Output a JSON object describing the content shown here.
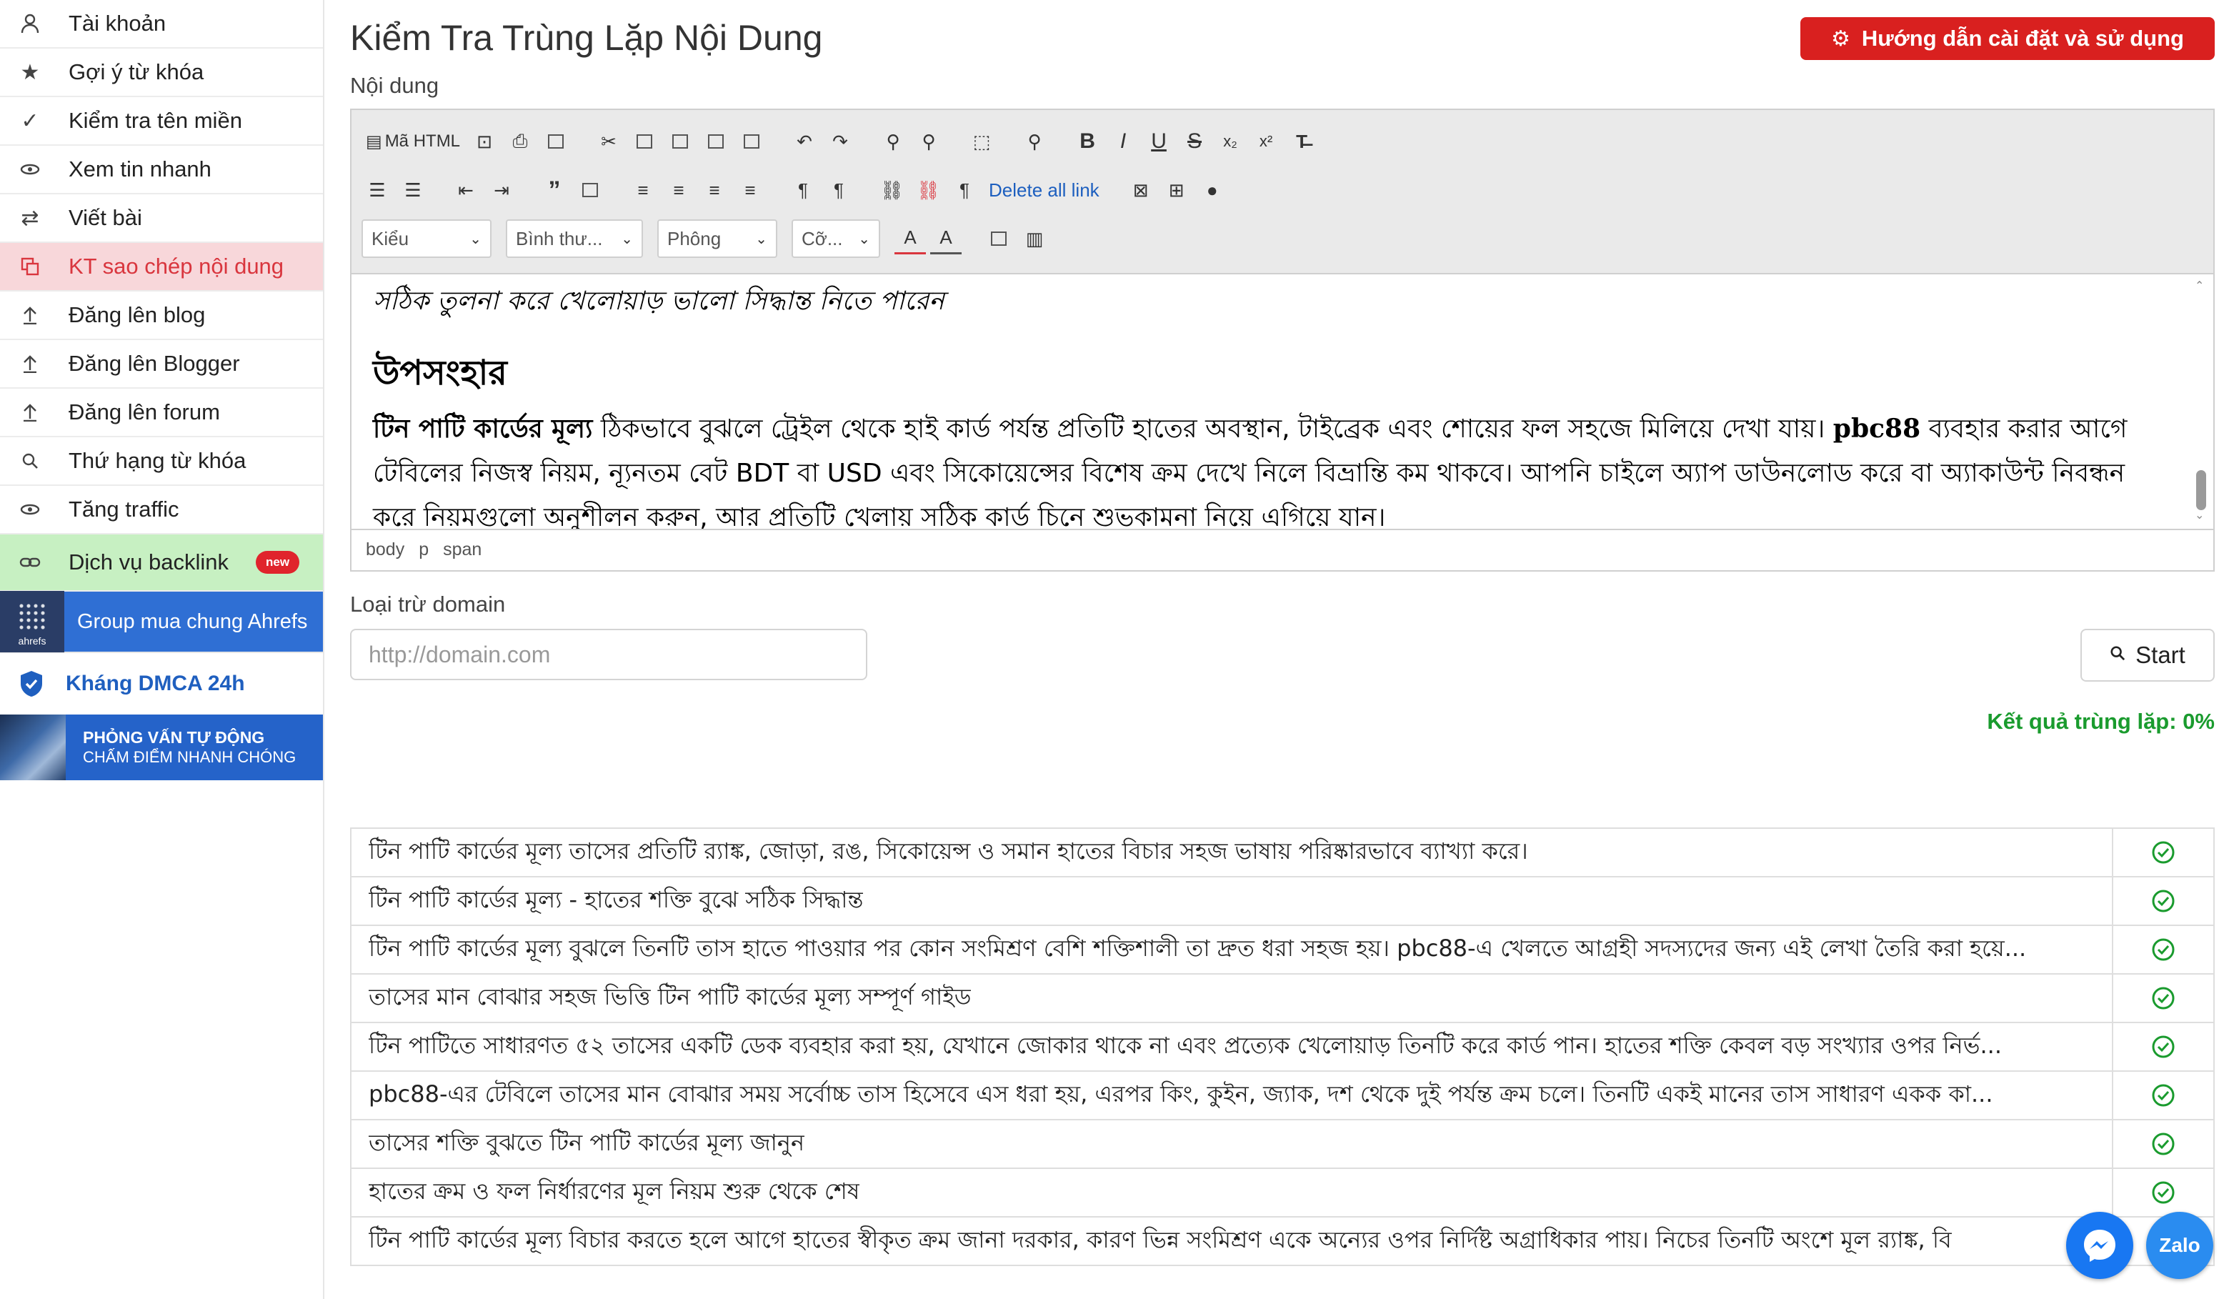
{
  "sidebar": {
    "items": [
      {
        "label": "Tài khoản",
        "icon": "user-icon"
      },
      {
        "label": "Gợi ý từ khóa",
        "icon": "star-icon"
      },
      {
        "label": "Kiểm tra tên miền",
        "icon": "check-icon"
      },
      {
        "label": "Xem tin nhanh",
        "icon": "eye-icon"
      },
      {
        "label": "Viết bài",
        "icon": "swap-icon"
      },
      {
        "label": "KT sao chép nội dung",
        "icon": "copy-icon"
      },
      {
        "label": "Đăng lên blog",
        "icon": "upload-icon"
      },
      {
        "label": "Đăng lên Blogger",
        "icon": "upload-icon"
      },
      {
        "label": "Đăng lên forum",
        "icon": "upload-icon"
      },
      {
        "label": "Thứ hạng từ khóa",
        "icon": "search-icon"
      },
      {
        "label": "Tăng traffic",
        "icon": "eye-icon"
      },
      {
        "label": "Dịch vụ backlink",
        "icon": "link-icon",
        "badge": "new"
      }
    ],
    "ahrefs_banner": {
      "logo_text": "ahrefs",
      "label": "Group mua chung Ahrefs"
    },
    "dmca": {
      "label": "Kháng DMCA 24h"
    },
    "interview_banner": {
      "line1": "PHỎNG VẤN TỰ ĐỘNG",
      "line2": "CHẤM ĐIỂM NHANH CHÓNG"
    }
  },
  "header": {
    "title": "Kiểm Tra Trùng Lặp Nội Dung",
    "guide_button": "Hướng dẫn cài đặt và sử dụng"
  },
  "editor": {
    "label": "Nội dung",
    "toolbar": {
      "source_label": "Mã HTML",
      "delete_links_label": "Delete all link",
      "bold": "B",
      "italic": "I",
      "underline": "U",
      "strike": "S",
      "subscript": "x₂",
      "superscript": "x²",
      "selects": {
        "style": "Kiểu",
        "format": "Bình thư...",
        "font": "Phông",
        "size": "Cỡ..."
      }
    },
    "content": {
      "italic_line": "সঠিক তুলনা করে খেলোয়াড় ভালো সিদ্ধান্ত নিতে পারেন",
      "heading": "উপসংহার",
      "para_bold": "টিন পাটি কার্ডের মূল্য",
      "para_text": " ঠিকভাবে বুঝলে ট্রেইল থেকে হাই কার্ড পর্যন্ত প্রতিটি হাতের অবস্থান, টাইব্রেক এবং শোয়ের ফল সহজে মিলিয়ে দেখা যায়। ",
      "para_brand": "pbc88",
      "para_text2": " ব্যবহার করার আগে টেবিলের নিজস্ব নিয়ম, ন্যূনতম বেট BDT বা USD এবং সিকোয়েন্সের বিশেষ ক্রম দেখে নিলে বিভ্রান্তি কম থাকবে। আপনি চাইলে অ্যাপ ডাউনলোড করে বা অ্যাকাউন্ট নিবন্ধন করে নিয়মগুলো অনুশীলন করুন, আর প্রতিটি খেলায় সঠিক কার্ড চিনে শুভকামনা নিয়ে এগিয়ে যান।"
    },
    "status_path": [
      "body",
      "p",
      "span"
    ]
  },
  "exclude": {
    "label": "Loại trừ domain",
    "placeholder": "http://domain.com"
  },
  "start_button": "Start",
  "result_text": "Kết quả trùng lặp: 0%",
  "results": [
    "টিন পাটি কার্ডের মূল্য তাসের প্রতিটি র‍্যাঙ্ক, জোড়া, রঙ, সিকোয়েন্স ও সমান হাতের বিচার সহজ ভাষায় পরিষ্কারভাবে ব্যাখ্যা করে।",
    "টিন পাটি কার্ডের মূল্য - হাতের শক্তি বুঝে সঠিক সিদ্ধান্ত",
    "টিন পাটি কার্ডের মূল্য বুঝলে তিনটি তাস হাতে পাওয়ার পর কোন সংমিশ্রণ বেশি শক্তিশালী তা দ্রুত ধরা সহজ হয়। pbc88-এ খেলতে আগ্রহী সদস্যদের জন্য এই লেখা তৈরি করা হয়ে...",
    "তাসের মান বোঝার সহজ ভিত্তি টিন পাটি কার্ডের মূল্য সম্পূর্ণ গাইড",
    "টিন পাটিতে সাধারণত ৫২ তাসের একটি ডেক ব্যবহার করা হয়, যেখানে জোকার থাকে না এবং প্রত্যেক খেলোয়াড় তিনটি করে কার্ড পান। হাতের শক্তি কেবল বড় সংখ্যার ওপর নির্ভ...",
    "pbc88-এর টেবিলে তাসের মান বোঝার সময় সর্বোচ্চ তাস হিসেবে এস ধরা হয়, এরপর কিং, কুইন, জ্যাক, দশ থেকে দুই পর্যন্ত ক্রম চলে। তিনটি একই মানের তাস সাধারণ একক কা...",
    "তাসের শক্তি বুঝতে টিন পাটি কার্ডের মূল্য জানুন",
    "হাতের ক্রম ও ফল নির্ধারণের মূল নিয়ম শুরু থেকে শেষ",
    "টিন পাটি কার্ডের মূল্য বিচার করতে হলে আগে হাতের স্বীকৃত ক্রম জানা দরকার, কারণ ভিন্ন সংমিশ্রণ একে অন্যের ওপর নির্দিষ্ট অগ্রাধিকার পায়। নিচের তিনটি অংশে মূল র‍্যাঙ্ক, বি"
  ],
  "floating": {
    "zalo": "Zalo"
  },
  "colors": {
    "accent_red": "#d9201f",
    "result_green": "#1a9b2e",
    "brand_blue": "#2f6fd4"
  }
}
